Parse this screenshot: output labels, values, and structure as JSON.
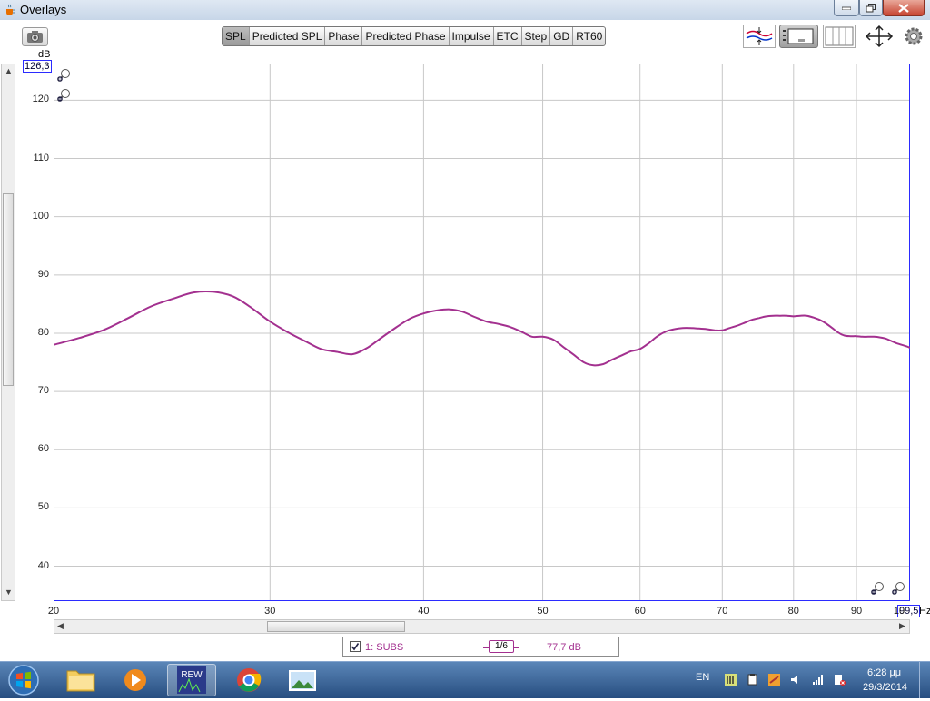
{
  "window": {
    "title": "Overlays"
  },
  "tabs": [
    {
      "label": "SPL",
      "active": true
    },
    {
      "label": "Predicted SPL"
    },
    {
      "label": "Phase"
    },
    {
      "label": "Predicted Phase"
    },
    {
      "label": "Impulse"
    },
    {
      "label": "ETC"
    },
    {
      "label": "Step"
    },
    {
      "label": "GD"
    },
    {
      "label": "RT60"
    }
  ],
  "chart_data": {
    "type": "line",
    "ylabel": "dB",
    "xunit": "Hz",
    "xscale": "log",
    "xlim": [
      20,
      99.5
    ],
    "ylim": [
      34,
      126.3
    ],
    "ymax_box": "126,3",
    "xmax_box": "99,5",
    "yticks": [
      "120",
      "110",
      "100",
      "90",
      "80",
      "70",
      "60",
      "50",
      "40"
    ],
    "ytick_values": [
      120,
      110,
      100,
      90,
      80,
      70,
      60,
      50,
      40
    ],
    "xticks": [
      "20",
      "30",
      "40",
      "50",
      "60",
      "70",
      "80",
      "90",
      "10"
    ],
    "xtick_values": [
      20,
      30,
      40,
      50,
      60,
      70,
      80,
      90,
      100
    ],
    "grid": true,
    "color": "#a3308f",
    "series": [
      {
        "name": "1: SUBS",
        "x": [
          20,
          21,
          22,
          23,
          24,
          25,
          26,
          27,
          28,
          29,
          30,
          31,
          32,
          33,
          34,
          35,
          36,
          37,
          38,
          39,
          40,
          41,
          42,
          43,
          44,
          45,
          46,
          47,
          48,
          49,
          50,
          51,
          52,
          53,
          54,
          55,
          56,
          57,
          58,
          59,
          60,
          61,
          62,
          63,
          64,
          65,
          66,
          67,
          68,
          69,
          70,
          71,
          72,
          73,
          74,
          75,
          76,
          77,
          78,
          79,
          80,
          81,
          82,
          83,
          84,
          85,
          86,
          87,
          88,
          89,
          90,
          91,
          92,
          93,
          94,
          95,
          96,
          97,
          98,
          99,
          99.5
        ],
        "y": [
          78.0,
          79.2,
          80.6,
          82.6,
          84.6,
          85.9,
          87.0,
          87.1,
          86.3,
          84.3,
          82.0,
          80.2,
          78.7,
          77.3,
          76.8,
          76.4,
          77.5,
          79.3,
          81.0,
          82.5,
          83.4,
          83.9,
          84.1,
          83.7,
          82.8,
          82.0,
          81.6,
          81.1,
          80.3,
          79.4,
          79.4,
          78.9,
          77.6,
          76.3,
          75.0,
          74.5,
          74.7,
          75.5,
          76.2,
          76.9,
          77.3,
          78.3,
          79.5,
          80.3,
          80.7,
          80.9,
          80.9,
          80.8,
          80.7,
          80.5,
          80.5,
          80.9,
          81.3,
          81.8,
          82.3,
          82.6,
          82.9,
          83.0,
          83.0,
          83.0,
          82.9,
          83.0,
          83.0,
          82.7,
          82.3,
          81.7,
          80.9,
          80.1,
          79.6,
          79.5,
          79.5,
          79.4,
          79.4,
          79.4,
          79.3,
          79.1,
          78.7,
          78.3,
          78.0,
          77.7,
          77.5
        ]
      }
    ]
  },
  "legend": {
    "checked": true,
    "series_label": "1: SUBS",
    "smoothing": "1/6",
    "value": "77,7 dB"
  },
  "taskbar": {
    "language": "EN",
    "time": "6:28 μμ",
    "date": "29/3/2014",
    "apps": [
      "start-orb",
      "explorer",
      "media-player",
      "rew",
      "chrome",
      "photo-viewer"
    ],
    "active_app": "rew"
  },
  "colors": {
    "trace": "#a3308f",
    "grid": "#c8c8c8",
    "axis_box": "#2b2bff",
    "taskbar": "#2f5b8f"
  }
}
